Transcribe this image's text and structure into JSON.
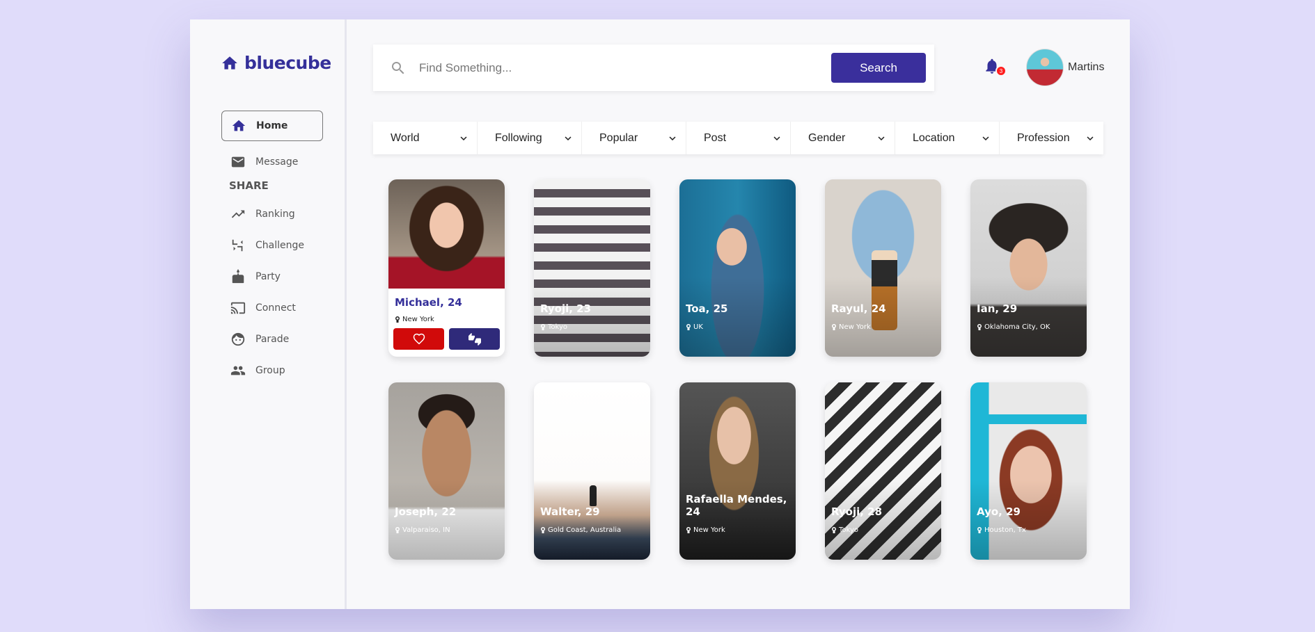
{
  "brand": {
    "name": "bluecube",
    "color": "#35309a"
  },
  "sidebar": {
    "items": [
      {
        "label": "Home",
        "icon": "home-icon",
        "active": true
      },
      {
        "label": "Message",
        "icon": "mail-icon"
      }
    ],
    "section_title": "SHARE",
    "share_items": [
      {
        "label": "Ranking",
        "icon": "trending-up-icon"
      },
      {
        "label": "Challenge",
        "icon": "challenge-icon"
      },
      {
        "label": "Party",
        "icon": "cake-icon"
      },
      {
        "label": "Connect",
        "icon": "cast-icon"
      },
      {
        "label": "Parade",
        "icon": "face-icon"
      },
      {
        "label": "Group",
        "icon": "group-icon"
      }
    ]
  },
  "search": {
    "placeholder": "Find Something...",
    "button_label": "Search"
  },
  "notifications": {
    "count": "3"
  },
  "user": {
    "name": "Martins"
  },
  "filters": [
    "World",
    "Following",
    "Popular",
    "Post",
    "Gender",
    "Location",
    "Profession"
  ],
  "cards": [
    {
      "name": "Michael, 24",
      "location": "New York",
      "featured": true
    },
    {
      "name": "Ryoji, 23",
      "location": "Tokyo"
    },
    {
      "name": "Toa, 25",
      "location": "UK"
    },
    {
      "name": "Rayul, 24",
      "location": "New York"
    },
    {
      "name": "Ian, 29",
      "location": "Oklahoma City, OK"
    },
    {
      "name": "Joseph, 22",
      "location": "Valparaiso, IN"
    },
    {
      "name": "Walter, 29",
      "location": "Gold Coast, Australia"
    },
    {
      "name": "Rafaella Mendes, 24",
      "location": "New York"
    },
    {
      "name": "Ryoji, 28",
      "location": "Tokyo"
    },
    {
      "name": "Ayo, 29",
      "location": "Houston, Tx"
    }
  ],
  "colors": {
    "accent": "#3a2f9c",
    "like": "#d10a0a",
    "dislike": "#2f2a7a",
    "badge": "#ff1d1d",
    "background": "#e0dcfa"
  }
}
